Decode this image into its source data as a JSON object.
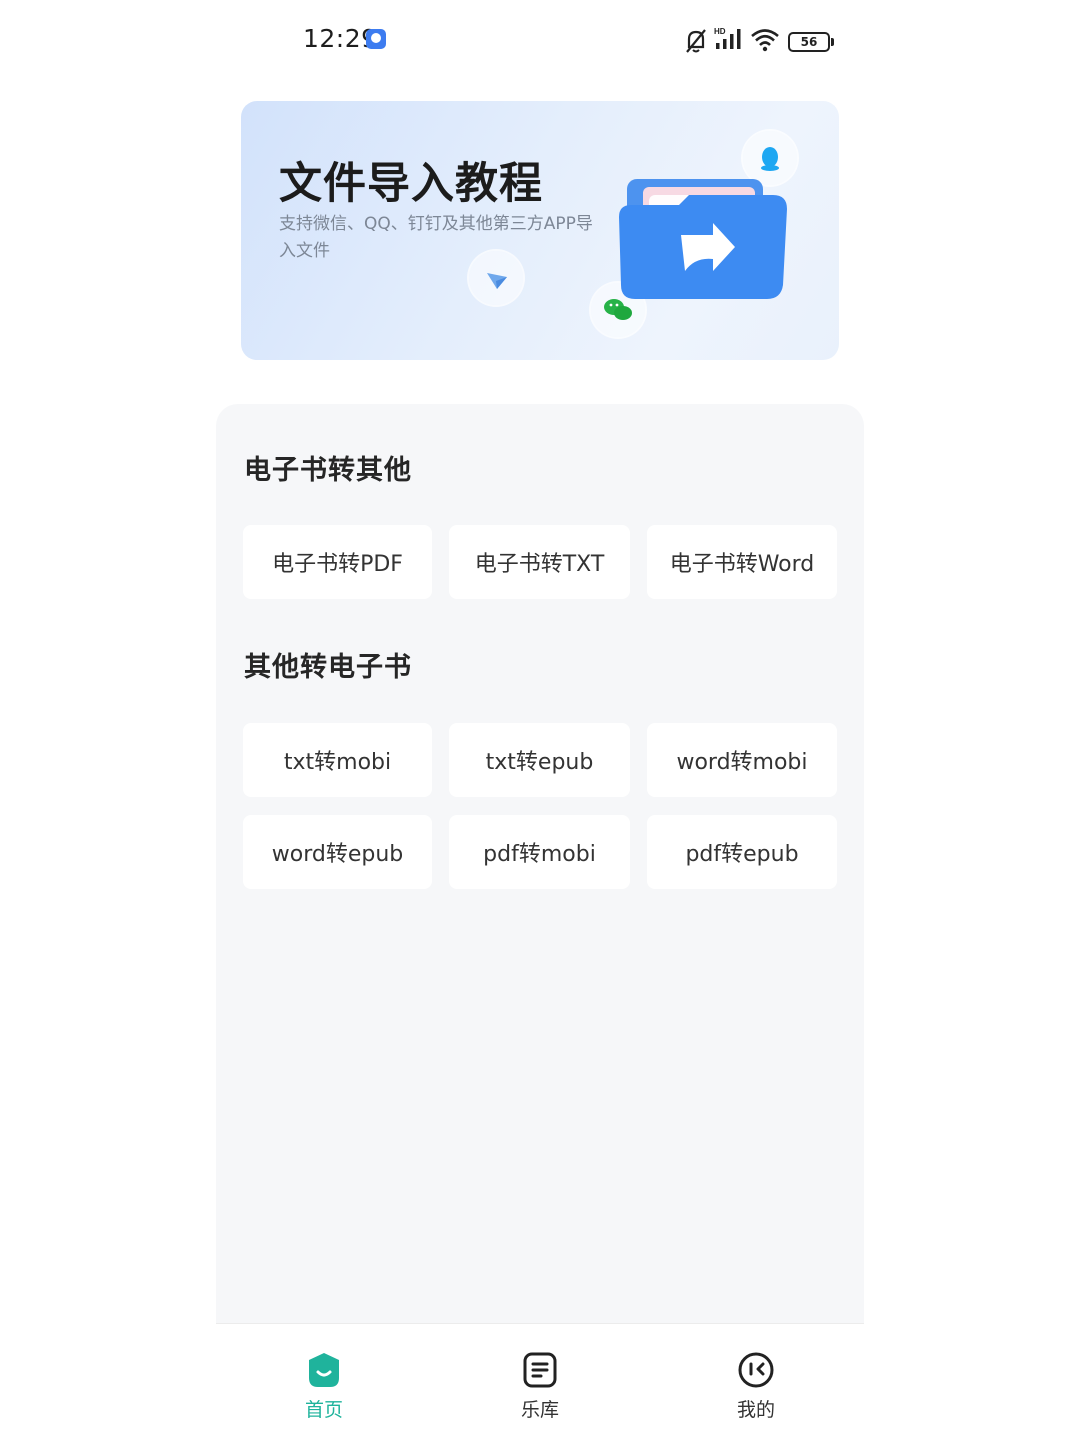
{
  "status_bar": {
    "time": "12:29",
    "battery": "56",
    "icons": [
      "app-notification-icon",
      "mute-bell-icon",
      "hd-signal-icon",
      "wifi-icon",
      "battery-icon"
    ]
  },
  "banner": {
    "title": "文件导入教程",
    "subtitle": "支持微信、QQ、钉钉及其他第三方APP导入文件",
    "icons": [
      "qq-icon",
      "paper-plane-icon",
      "wechat-icon",
      "folder-share-icon"
    ]
  },
  "sections": [
    {
      "title": "电子书转其他",
      "options": [
        "电子书转PDF",
        "电子书转TXT",
        "电子书转Word"
      ]
    },
    {
      "title": "其他转电子书",
      "options": [
        "txt转mobi",
        "txt转epub",
        "word转mobi",
        "word转epub",
        "pdf转mobi",
        "pdf转epub"
      ]
    }
  ],
  "bottom_nav": [
    {
      "label": "首页",
      "icon": "home-face-icon",
      "active": true
    },
    {
      "label": "乐库",
      "icon": "library-icon",
      "active": false
    },
    {
      "label": "我的",
      "icon": "profile-icon",
      "active": false
    }
  ],
  "colors": {
    "accent": "#1fb39c",
    "panel_bg": "#f6f7f9",
    "folder_blue": "#3d8bf2"
  }
}
